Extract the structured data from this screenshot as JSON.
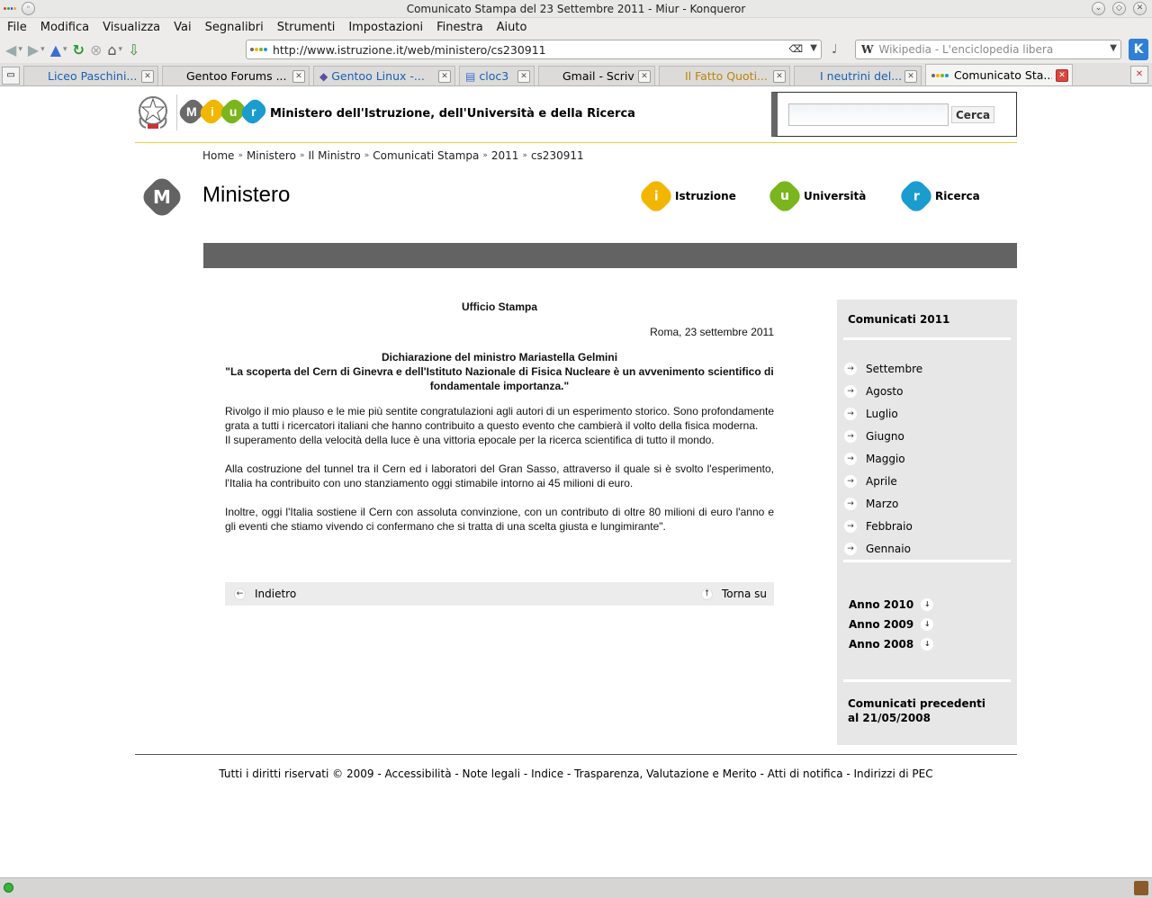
{
  "window": {
    "title": "Comunicato Stampa del 23 Settembre 2011 - Miur - Konqueror"
  },
  "menu": [
    "File",
    "Modifica",
    "Visualizza",
    "Vai",
    "Segnalibri",
    "Strumenti",
    "Impostazioni",
    "Finestra",
    "Aiuto"
  ],
  "toolbar": {
    "url": "http://www.istruzione.it/web/ministero/cs230911",
    "search_placeholder": "Wikipedia - L'enciclopedia libera",
    "search_engine_glyph": "W"
  },
  "tabs": [
    {
      "label": "Liceo Paschini...",
      "color": "#1a5fb4"
    },
    {
      "label": "Gentoo Forums ...",
      "color": "#222222"
    },
    {
      "label": "Gentoo Linux -...",
      "color": "#1a5fb4"
    },
    {
      "label": "cloc3",
      "color": "#1a5fb4"
    },
    {
      "label": "Gmail - Scrivi",
      "color": "#222222"
    },
    {
      "label": "Il Fatto Quoti...",
      "color": "#b8860b"
    },
    {
      "label": "I neutrini del...",
      "color": "#1a5fb4"
    },
    {
      "label": "Comunicato Sta...",
      "color": "#222222"
    }
  ],
  "site": {
    "ministry_name": "Ministero dell'Istruzione, dell'Università e della Ricerca",
    "logo_letters": [
      "M",
      "i",
      "u",
      "r"
    ],
    "logo_colors": [
      "#6a6a6a",
      "#f3b600",
      "#7ab51d",
      "#1a9ccf"
    ],
    "search_button": "Cerca"
  },
  "breadcrumb": [
    "Home",
    "Ministero",
    "Il Ministro",
    "Comunicati Stampa",
    "2011",
    "cs230911"
  ],
  "breadcrumb_sep": "»",
  "section": {
    "icon_letter": "M",
    "title": "Ministero",
    "links": [
      {
        "letter": "i",
        "label": "Istruzione",
        "color": "#f3b600"
      },
      {
        "letter": "u",
        "label": "Università",
        "color": "#7ab51d"
      },
      {
        "letter": "r",
        "label": "Ricerca",
        "color": "#1a9ccf"
      }
    ]
  },
  "article": {
    "office": "Ufficio Stampa",
    "dateline": "Roma, 23 settembre 2011",
    "decl_title": "Dichiarazione del ministro Mariastella Gelmini",
    "decl_quote": "\"La scoperta del Cern di Ginevra e dell'Istituto Nazionale di Fisica Nucleare è un avvenimento scientifico di fondamentale importanza.\"",
    "p1": "Rivolgo il mio plauso e le mie più sentite congratulazioni agli autori di un esperimento storico. Sono profondamente grata a tutti i ricercatori italiani che hanno contribuito a questo evento che cambierà il volto della fisica moderna.",
    "p1b": "Il superamento della velocità della luce è una vittoria epocale per la ricerca scientifica di tutto il mondo.",
    "p2": "Alla costruzione del tunnel tra il Cern ed i laboratori del Gran Sasso, attraverso il quale si è svolto l'esperimento, l'Italia ha contribuito con uno stanziamento oggi stimabile intorno ai 45 milioni di euro.",
    "p3": "Inoltre, oggi l'Italia sostiene il Cern con assoluta convinzione, con un contributo di oltre 80 milioni di euro l'anno e gli eventi che stiamo vivendo ci confermano che si tratta di una scelta giusta e lungimirante\"."
  },
  "nav": {
    "back": "Indietro",
    "top": "Torna su"
  },
  "sidebar": {
    "heading": "Comunicati 2011",
    "months": [
      "Settembre",
      "Agosto",
      "Luglio",
      "Giugno",
      "Maggio",
      "Aprile",
      "Marzo",
      "Febbraio",
      "Gennaio"
    ],
    "years": [
      "Anno 2010",
      "Anno 2009",
      "Anno 2008"
    ],
    "previous": "Comunicati precedenti al 21/05/2008"
  },
  "footer": "Tutti i diritti riservati © 2009 - Accessibilità - Note legali - Indice - Trasparenza, Valutazione e Merito - Atti di notifica - Indirizzi di PEC"
}
